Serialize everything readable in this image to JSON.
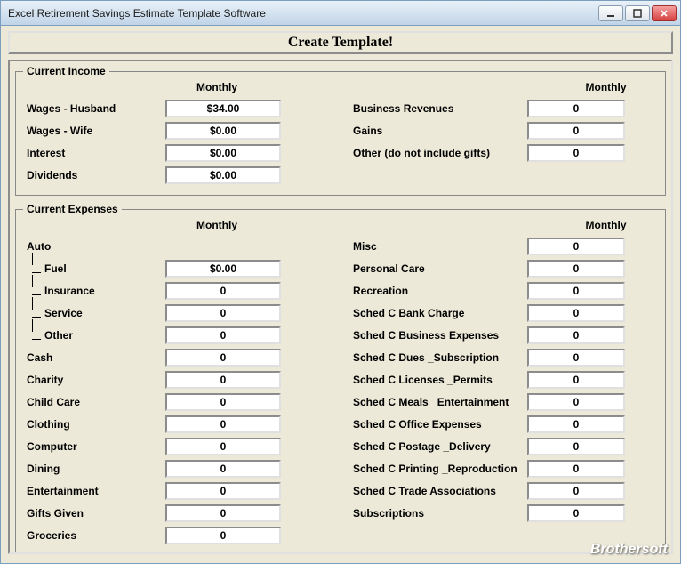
{
  "window": {
    "title": "Excel Retirement Savings Estimate Template Software"
  },
  "createButton": "Create Template!",
  "income": {
    "legend": "Current Income",
    "monthlyHeader": "Monthly",
    "left": [
      {
        "label": "Wages - Husband",
        "value": "$34.00"
      },
      {
        "label": "Wages - Wife",
        "value": "$0.00"
      },
      {
        "label": "Interest",
        "value": "$0.00"
      },
      {
        "label": "Dividends",
        "value": "$0.00"
      }
    ],
    "right": [
      {
        "label": "Business Revenues",
        "value": "0"
      },
      {
        "label": "Gains",
        "value": "0"
      },
      {
        "label": "Other (do not include gifts)",
        "value": "0"
      }
    ]
  },
  "expenses": {
    "legend": "Current Expenses",
    "monthlyHeader": "Monthly",
    "left": [
      {
        "label": "Auto",
        "value": "",
        "header": true
      },
      {
        "label": "Fuel",
        "value": "$0.00",
        "sub": true
      },
      {
        "label": "Insurance",
        "value": "0",
        "sub": true
      },
      {
        "label": "Service",
        "value": "0",
        "sub": true
      },
      {
        "label": "Other",
        "value": "0",
        "sub": true,
        "last": true
      },
      {
        "label": "Cash",
        "value": "0"
      },
      {
        "label": "Charity",
        "value": "0"
      },
      {
        "label": "Child Care",
        "value": "0"
      },
      {
        "label": "Clothing",
        "value": "0"
      },
      {
        "label": "Computer",
        "value": "0"
      },
      {
        "label": "Dining",
        "value": "0"
      },
      {
        "label": "Entertainment",
        "value": "0"
      },
      {
        "label": "Gifts Given",
        "value": "0"
      },
      {
        "label": "Groceries",
        "value": "0"
      }
    ],
    "right": [
      {
        "label": "Misc",
        "value": "0"
      },
      {
        "label": "Personal Care",
        "value": "0"
      },
      {
        "label": "Recreation",
        "value": "0"
      },
      {
        "label": "Sched C Bank Charge",
        "value": "0"
      },
      {
        "label": "Sched C Business Expenses",
        "value": "0"
      },
      {
        "label": "Sched C Dues _Subscription",
        "value": "0"
      },
      {
        "label": "Sched C Licenses _Permits",
        "value": "0"
      },
      {
        "label": "Sched C Meals _Entertainment",
        "value": "0"
      },
      {
        "label": "Sched C Office Expenses",
        "value": "0"
      },
      {
        "label": "Sched C Postage _Delivery",
        "value": "0"
      },
      {
        "label": "Sched C Printing _Reproduction",
        "value": "0"
      },
      {
        "label": "Sched C Trade Associations",
        "value": "0"
      },
      {
        "label": "Subscriptions",
        "value": "0"
      }
    ]
  },
  "watermark": "Brothersoft"
}
